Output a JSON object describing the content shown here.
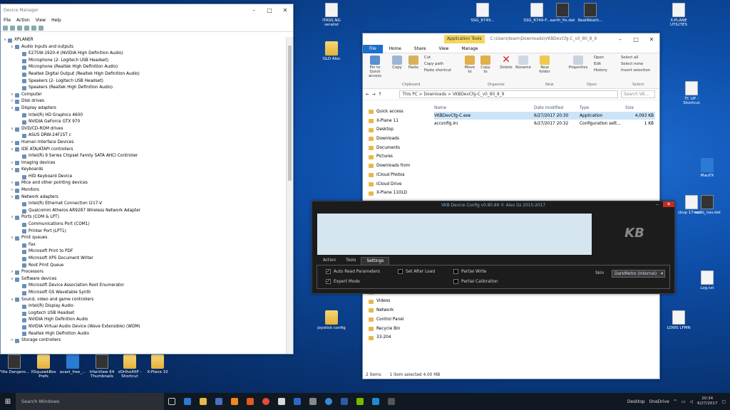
{
  "desktop_icons": [
    {
      "label": "ITASS.NG seralist",
      "kind": "file"
    },
    {
      "label": "OLD Alec",
      "kind": "folder"
    },
    {
      "label": "SSG_8749...",
      "kind": "file"
    },
    {
      "label": "SSG_8749-F...",
      "kind": "file"
    },
    {
      "label": "earth_fix.dat",
      "kind": "app"
    },
    {
      "label": "RealWeath...",
      "kind": "app"
    },
    {
      "label": "X-PLANE UTILITES",
      "kind": "file"
    },
    {
      "label": "TC UP - Shortcut",
      "kind": "file"
    },
    {
      "label": "MauFX",
      "kind": "app2"
    },
    {
      "label": "ckup 17 sco...",
      "kind": "file"
    },
    {
      "label": "earth_nav.dat",
      "kind": "app"
    },
    {
      "label": "Log.txt",
      "kind": "file"
    },
    {
      "label": "LOWS LFMN",
      "kind": "file"
    },
    {
      "label": "joystick config",
      "kind": "folder"
    },
    {
      "label": "Flite Dangero...",
      "kind": "app"
    },
    {
      "label": "XSquawkBox Prefs",
      "kind": "folder"
    },
    {
      "label": "avast_free_...",
      "kind": "app2"
    },
    {
      "label": "IrfanView 64 Thumbnails",
      "kind": "app"
    },
    {
      "label": "zOrtho4XP - Shortcut",
      "kind": "folder"
    },
    {
      "label": "X-Plane 10",
      "kind": "folder"
    }
  ],
  "device_manager": {
    "title": "Device Manager",
    "menu": [
      "File",
      "Action",
      "View",
      "Help"
    ],
    "tree": [
      {
        "level": 0,
        "exp": "v",
        "label": "XPLANER"
      },
      {
        "level": 1,
        "exp": "v",
        "label": "Audio inputs and outputs"
      },
      {
        "level": 2,
        "exp": "",
        "label": "E275W-1920-4 (NVIDIA High Definition Audio)"
      },
      {
        "level": 2,
        "exp": "",
        "label": "Microphone (2- Logitech USB Headset)"
      },
      {
        "level": 2,
        "exp": "",
        "label": "Microphone (Realtek High Definition Audio)"
      },
      {
        "level": 2,
        "exp": "",
        "label": "Realtek Digital Output (Realtek High Definition Audio)"
      },
      {
        "level": 2,
        "exp": "",
        "label": "Speakers (2- Logitech USB Headset)"
      },
      {
        "level": 2,
        "exp": "",
        "label": "Speakers (Realtek High Definition Audio)"
      },
      {
        "level": 1,
        "exp": ">",
        "label": "Computer"
      },
      {
        "level": 1,
        "exp": ">",
        "label": "Disk drives"
      },
      {
        "level": 1,
        "exp": "v",
        "label": "Display adapters"
      },
      {
        "level": 2,
        "exp": "",
        "label": "Intel(R) HD Graphics 4600"
      },
      {
        "level": 2,
        "exp": "",
        "label": "NVIDIA GeForce GTX 970"
      },
      {
        "level": 1,
        "exp": "v",
        "label": "DVD/CD-ROM drives"
      },
      {
        "level": 2,
        "exp": "",
        "label": "ASUS DRW-24F1ST   c"
      },
      {
        "level": 1,
        "exp": ">",
        "label": "Human Interface Devices"
      },
      {
        "level": 1,
        "exp": "v",
        "label": "IDE ATA/ATAPI controllers"
      },
      {
        "level": 2,
        "exp": "",
        "label": "Intel(R) 9 Series Chipset Family SATA AHCI Controller"
      },
      {
        "level": 1,
        "exp": ">",
        "label": "Imaging devices"
      },
      {
        "level": 1,
        "exp": "v",
        "label": "Keyboards"
      },
      {
        "level": 2,
        "exp": "",
        "label": "HID Keyboard Device"
      },
      {
        "level": 1,
        "exp": ">",
        "label": "Mice and other pointing devices"
      },
      {
        "level": 1,
        "exp": ">",
        "label": "Monitors"
      },
      {
        "level": 1,
        "exp": "v",
        "label": "Network adapters"
      },
      {
        "level": 2,
        "exp": "",
        "label": "Intel(R) Ethernet Connection I217-V"
      },
      {
        "level": 2,
        "exp": "",
        "label": "Qualcomm Atheros AR9287 Wireless Network Adapter"
      },
      {
        "level": 1,
        "exp": "v",
        "label": "Ports (COM & LPT)"
      },
      {
        "level": 2,
        "exp": "",
        "label": "Communications Port (COM1)"
      },
      {
        "level": 2,
        "exp": "",
        "label": "Printer Port (LPT1)"
      },
      {
        "level": 1,
        "exp": "v",
        "label": "Print queues"
      },
      {
        "level": 2,
        "exp": "",
        "label": "Fax"
      },
      {
        "level": 2,
        "exp": "",
        "label": "Microsoft Print to PDF"
      },
      {
        "level": 2,
        "exp": "",
        "label": "Microsoft XPS Document Writer"
      },
      {
        "level": 2,
        "exp": "",
        "label": "Root Print Queue"
      },
      {
        "level": 1,
        "exp": ">",
        "label": "Processors"
      },
      {
        "level": 1,
        "exp": "v",
        "label": "Software devices"
      },
      {
        "level": 2,
        "exp": "",
        "label": "Microsoft Device Association Root Enumerator"
      },
      {
        "level": 2,
        "exp": "",
        "label": "Microsoft GS Wavetable Synth"
      },
      {
        "level": 1,
        "exp": "v",
        "label": "Sound, video and game controllers"
      },
      {
        "level": 2,
        "exp": "",
        "label": "Intel(R) Display Audio"
      },
      {
        "level": 2,
        "exp": "",
        "label": "Logitech USB Headset"
      },
      {
        "level": 2,
        "exp": "",
        "label": "NVIDIA High Definition Audio"
      },
      {
        "level": 2,
        "exp": "",
        "label": "NVIDIA Virtual Audio Device (Wave Extensible) (WDM)"
      },
      {
        "level": 2,
        "exp": "",
        "label": "Realtek High Definition Audio"
      },
      {
        "level": 1,
        "exp": ">",
        "label": "Storage controllers"
      }
    ]
  },
  "explorer": {
    "app_tools": "Application Tools",
    "path_title": "C:\\Users\\team\\Downloads\\VKBDevCfg-C_v0_80_8_9",
    "tabs": [
      "File",
      "Home",
      "Share",
      "View",
      "Manage"
    ],
    "ribbon": {
      "pin": "Pin to Quick access",
      "copy": "Copy",
      "paste": "Paste",
      "cut": "Cut",
      "copy_path": "Copy path",
      "paste_shortcut": "Paste shortcut",
      "move_to": "Move to",
      "copy_to": "Copy to",
      "delete": "Delete",
      "rename": "Rename",
      "new_folder": "New folder",
      "properties": "Properties",
      "open": "Open",
      "edit": "Edit",
      "history": "History",
      "select_all": "Select all",
      "select_none": "Select none",
      "invert_selection": "Invert selection",
      "groups": [
        "Clipboard",
        "Organize",
        "New",
        "Open",
        "Select"
      ]
    },
    "breadcrumb": "This PC  >  Downloads  >  VKBDevCfg-C_v0_80_8_9",
    "search_placeholder": "Search VK...",
    "nav": [
      "Quick access",
      "X-Plane 11",
      "Desktop",
      "Downloads",
      "Documents",
      "Pictures",
      "Downloads from",
      "iCloud Photos",
      "iCloud Drive",
      "X-Plane 11OLD",
      "",
      "",
      "",
      "",
      "",
      "",
      "",
      "Documents",
      "Music",
      "Pictures",
      "Saved Pictures",
      "Videos",
      "Network",
      "Control Panel",
      "Recycle Bin",
      "33-204"
    ],
    "columns": [
      "Name",
      "Date modified",
      "Type",
      "Size"
    ],
    "files": [
      {
        "name": "VKBDevCfg-C.exe",
        "date": "6/27/2017 20:30",
        "type": "Application",
        "size": "4,093 KB",
        "selected": true
      },
      {
        "name": "acconfig.ini",
        "date": "6/27/2017 20:32",
        "type": "Configuration sett...",
        "size": "1 KB",
        "selected": false
      }
    ],
    "status_items": "2 items",
    "status_selected": "1 item selected  4.00 MB"
  },
  "vkb": {
    "title": "VKB Device Config v0.80.89  © Alex Oz 2015-2017",
    "logo": "KB",
    "tabs": [
      "Action",
      "Tools",
      "Settings"
    ],
    "active_tab": "Settings",
    "options": [
      {
        "label": "Auto Read Parameters",
        "checked": true
      },
      {
        "label": "Expert Mode",
        "checked": true
      },
      {
        "label": "Set After Load",
        "checked": false
      },
      {
        "label": "Partial Write",
        "checked": false
      },
      {
        "label": "Partial Calibration",
        "checked": false
      }
    ],
    "skin_label": "Skin",
    "skin_value": "DarkMetro (Internal)"
  },
  "taskbar": {
    "search_placeholder": "Search Windows",
    "desktop_label": "Desktop",
    "onedrive_label": "OneDrive",
    "time": "20:34",
    "date": "6/27/2017"
  }
}
